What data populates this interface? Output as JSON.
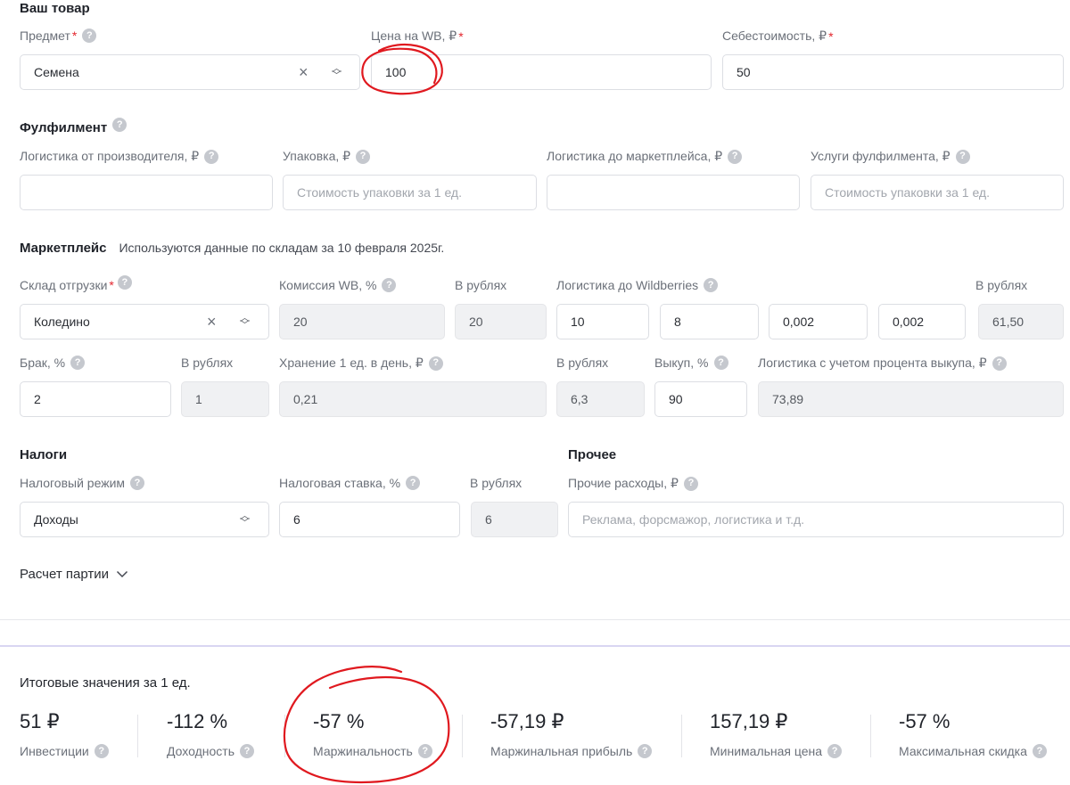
{
  "product": {
    "title": "Ваш товар",
    "subject_label": "Предмет",
    "subject_value": "Семена",
    "price_label": "Цена на WB, ₽",
    "price_value": "100",
    "cost_label": "Себестоимость, ₽",
    "cost_value": "50"
  },
  "fulfillment": {
    "title": "Фулфилмент",
    "logistics_mfr_label": "Логистика от производителя, ₽",
    "logistics_mfr_value": "",
    "packaging_label": "Упаковка, ₽",
    "packaging_placeholder": "Стоимость упаковки за 1 ед.",
    "logistics_mp_label": "Логистика до маркетплейса, ₽",
    "logistics_mp_value": "",
    "services_label": "Услуги фулфилмента, ₽",
    "services_placeholder": "Стоимость упаковки за 1 ед."
  },
  "marketplace": {
    "title": "Маркетплейс",
    "note": "Используются данные по складам за 10 февраля 2025г.",
    "warehouse_label": "Склад отгрузки",
    "warehouse_value": "Коледино",
    "commission_label": "Комиссия WB, %",
    "commission_value": "20",
    "rub_label": "В рублях",
    "commission_rub_value": "20",
    "logistics_wb_label": "Логистика до Wildberries",
    "logistics_wb_values": [
      "10",
      "8",
      "0,002",
      "0,002"
    ],
    "logistics_wb_rub_value": "61,50",
    "defect_label": "Брак, %",
    "defect_value": "2",
    "defect_rub_value": "1",
    "storage_label": "Хранение 1 ед. в день, ₽",
    "storage_value": "0,21",
    "storage_rub_value": "6,3",
    "buyout_label": "Выкуп, %",
    "buyout_value": "90",
    "logistics_buyout_label": "Логистика с учетом процента выкупа, ₽",
    "logistics_buyout_value": "73,89"
  },
  "taxes": {
    "title": "Налоги",
    "regime_label": "Налоговый режим",
    "regime_value": "Доходы",
    "rate_label": "Налоговая ставка, %",
    "rate_value": "6",
    "rub_label": "В рублях",
    "rub_value": "6"
  },
  "other": {
    "title": "Прочее",
    "label": "Прочие расходы, ₽",
    "placeholder": "Реклама, форсмажор, логистика и т.д."
  },
  "batch": {
    "label": "Расчет партии"
  },
  "results": {
    "title": "Итоговые значения за 1 ед.",
    "items": [
      {
        "value": "51 ₽",
        "label": "Инвестиции"
      },
      {
        "value": "-112 %",
        "label": "Доходность"
      },
      {
        "value": "-57 %",
        "label": "Маржинальность"
      },
      {
        "value": "-57,19 ₽",
        "label": "Маржинальная прибыль"
      },
      {
        "value": "157,19 ₽",
        "label": "Минимальная цена"
      },
      {
        "value": "-57 %",
        "label": "Максимальная скидка"
      }
    ]
  },
  "colors": {
    "annotation": "#e0191f",
    "required": "#e3262e",
    "accent_border": "#d9d6f2"
  }
}
